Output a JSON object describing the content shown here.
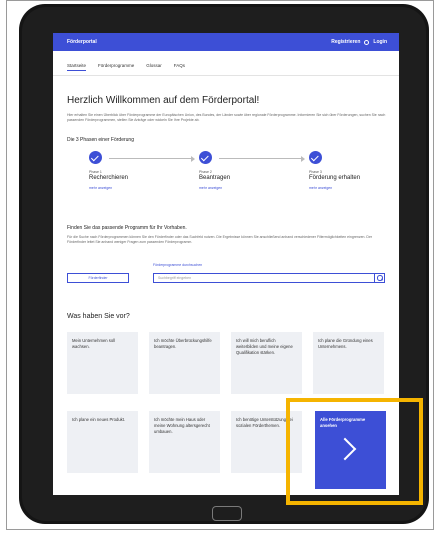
{
  "header": {
    "brand": "Förderportal",
    "register_login": "Registrieren",
    "login": "Login"
  },
  "nav": {
    "items": [
      "Startseite",
      "Förderprogramme",
      "Glossar",
      "FAQs"
    ]
  },
  "welcome": {
    "title": "Herzlich Willkommen auf dem Förderportal!",
    "intro": "Hier erhalten Sie einen Überblick über Förderprogramme der Europäischen Union, des Bundes, der Länder sowie über regionale Förderprogramme. Informieren Sie sich über Förderungen, suchen Sie nach passenden Förderprogrammen, stellen Sie Anträge oder wickeln Sie Ihre Projekte ab."
  },
  "phases": {
    "title": "Die 3 Phasen einer Förderung",
    "items": [
      {
        "label": "Phase 1",
        "name": "Recherchieren",
        "more": "mehr anzeigen"
      },
      {
        "label": "Phase 2",
        "name": "Beantragen",
        "more": "mehr anzeigen"
      },
      {
        "label": "Phase 3",
        "name": "Förderung erhalten",
        "more": "mehr anzeigen"
      }
    ]
  },
  "finder": {
    "title": "Finden Sie das passende Programm für Ihr Vorhaben.",
    "text": "Für die Suche nach Förderprogrammen können Sie den Förderfinder oder das Suchfeld nutzen. Die Ergebnisse können Sie anschließend anhand verschiedener Filtermöglichkeiten eingrenzen. Der Förderfinder leitet Sie anhand weniger Fragen zum passenden Förderprogramm.",
    "search_label": "Förderprogramme durchsuchen",
    "button": "Förderfinder",
    "placeholder": "Suchbegriff eingeben"
  },
  "plans": {
    "title": "Was haben Sie vor?",
    "cards": [
      "Mein Unternehmen soll wachsen.",
      "Ich möchte Überbrückungshilfe beantragen.",
      "Ich will mich beruflich weiterbilden und meine eigene Qualifikation stärken.",
      "Ich plane die Gründung eines Unternehmens.",
      "Ich plane ein neues Produkt.",
      "Ich möchte mein Haus oder meine Wohnung altersgerecht umbauen.",
      "Ich benötige Unterstützung bei sozialen Förderthemen."
    ],
    "cta": "Alle Förderprogramme ansehen"
  },
  "colors": {
    "accent": "#3d4fd6",
    "highlight": "#f5b400",
    "card": "#eef0f4"
  }
}
